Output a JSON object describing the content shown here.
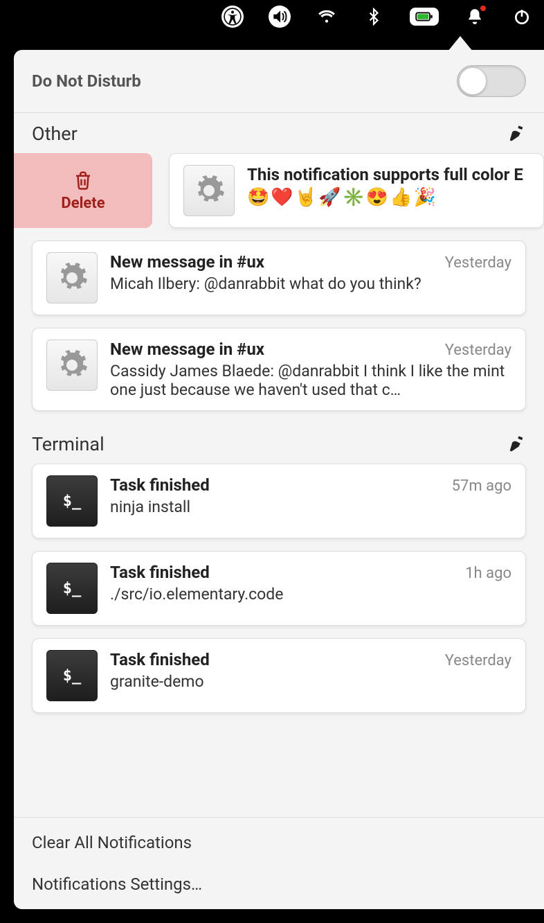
{
  "dnd": {
    "label": "Do Not Disturb",
    "enabled": false
  },
  "sections": [
    {
      "title": "Other",
      "swipe_delete_label": "Delete",
      "notifications": [
        {
          "icon": "gear",
          "title": "This notification supports full color E",
          "body_emoji": "🤩❤️🤘🚀✳️😍👍🎉",
          "time": "",
          "swiped": true
        },
        {
          "icon": "gear",
          "title": "New message in #ux",
          "body": "Micah Ilbery: @danrabbit what do you think?",
          "time": "Yesterday"
        },
        {
          "icon": "gear",
          "title": "New message in #ux",
          "body": "Cassidy James Blaede: @danrabbit I think I like the mint one just because we haven't used that c…",
          "time": "Yesterday"
        }
      ]
    },
    {
      "title": "Terminal",
      "notifications": [
        {
          "icon": "terminal",
          "title": "Task finished",
          "body": "ninja install",
          "time": "57m ago"
        },
        {
          "icon": "terminal",
          "title": "Task finished",
          "body": "./src/io.elementary.code",
          "time": "1h ago"
        },
        {
          "icon": "terminal",
          "title": "Task finished",
          "body": "granite-demo",
          "time": "Yesterday"
        }
      ]
    }
  ],
  "footer": {
    "clear_all": "Clear All Notifications",
    "settings": "Notifications Settings…"
  }
}
